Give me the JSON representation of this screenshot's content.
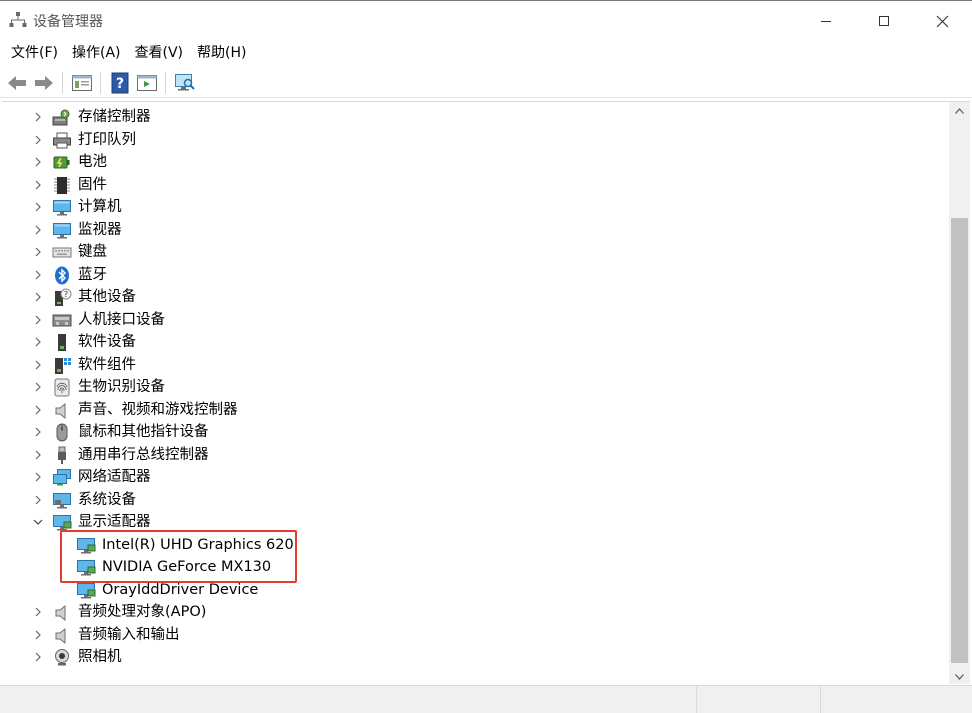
{
  "window": {
    "title": "设备管理器",
    "icon": "device-manager-icon"
  },
  "window_controls": {
    "minimize": "minimize-icon",
    "maximize": "maximize-icon",
    "close": "close-icon"
  },
  "menu": [
    {
      "id": "file",
      "label": "文件(F)"
    },
    {
      "id": "action",
      "label": "操作(A)"
    },
    {
      "id": "view",
      "label": "查看(V)"
    },
    {
      "id": "help",
      "label": "帮助(H)"
    }
  ],
  "toolbar": [
    "back-icon",
    "forward-icon",
    "properties-icon",
    "help-icon",
    "update-driver-icon",
    "scan-hardware-icon"
  ],
  "tree": {
    "nodes": [
      {
        "id": "storage",
        "label": "存储控制器",
        "icon": "storage-controller-icon",
        "expanded": false
      },
      {
        "id": "print-queue",
        "label": "打印队列",
        "icon": "printer-icon",
        "expanded": false
      },
      {
        "id": "battery",
        "label": "电池",
        "icon": "battery-icon",
        "expanded": false
      },
      {
        "id": "firmware",
        "label": "固件",
        "icon": "firmware-icon",
        "expanded": false
      },
      {
        "id": "computer",
        "label": "计算机",
        "icon": "computer-icon",
        "expanded": false
      },
      {
        "id": "monitor",
        "label": "监视器",
        "icon": "monitor-icon",
        "expanded": false
      },
      {
        "id": "keyboard",
        "label": "键盘",
        "icon": "keyboard-icon",
        "expanded": false
      },
      {
        "id": "bluetooth",
        "label": "蓝牙",
        "icon": "bluetooth-icon",
        "expanded": false
      },
      {
        "id": "other-devices",
        "label": "其他设备",
        "icon": "unknown-device-icon",
        "expanded": false
      },
      {
        "id": "hid",
        "label": "人机接口设备",
        "icon": "hid-icon",
        "expanded": false
      },
      {
        "id": "software-devices",
        "label": "软件设备",
        "icon": "software-device-icon",
        "expanded": false
      },
      {
        "id": "software-components",
        "label": "软件组件",
        "icon": "software-component-icon",
        "expanded": false
      },
      {
        "id": "biometric",
        "label": "生物识别设备",
        "icon": "fingerprint-icon",
        "expanded": false
      },
      {
        "id": "sound",
        "label": "声音、视频和游戏控制器",
        "icon": "speaker-icon",
        "expanded": false
      },
      {
        "id": "mouse",
        "label": "鼠标和其他指针设备",
        "icon": "mouse-icon",
        "expanded": false
      },
      {
        "id": "usb",
        "label": "通用串行总线控制器",
        "icon": "usb-icon",
        "expanded": false
      },
      {
        "id": "network",
        "label": "网络适配器",
        "icon": "network-adapter-icon",
        "expanded": false
      },
      {
        "id": "system",
        "label": "系统设备",
        "icon": "system-device-icon",
        "expanded": false
      },
      {
        "id": "display",
        "label": "显示适配器",
        "icon": "display-adapter-icon",
        "expanded": true,
        "children": [
          {
            "id": "intel-uhd",
            "label": "Intel(R) UHD Graphics 620",
            "icon": "display-adapter-icon"
          },
          {
            "id": "nvidia-mx130",
            "label": "NVIDIA GeForce MX130",
            "icon": "display-adapter-icon"
          },
          {
            "id": "oray",
            "label": "OrayIddDriver Device",
            "icon": "display-adapter-icon"
          }
        ]
      },
      {
        "id": "apo",
        "label": "音频处理对象(APO)",
        "icon": "speaker-icon",
        "expanded": false
      },
      {
        "id": "audio-io",
        "label": "音频输入和输出",
        "icon": "speaker-icon",
        "expanded": false
      },
      {
        "id": "camera",
        "label": "照相机",
        "icon": "camera-icon",
        "expanded": false
      }
    ]
  },
  "colors": {
    "highlight_border": "#e53a30",
    "scrollbar_thumb": "#c2c2c2"
  }
}
